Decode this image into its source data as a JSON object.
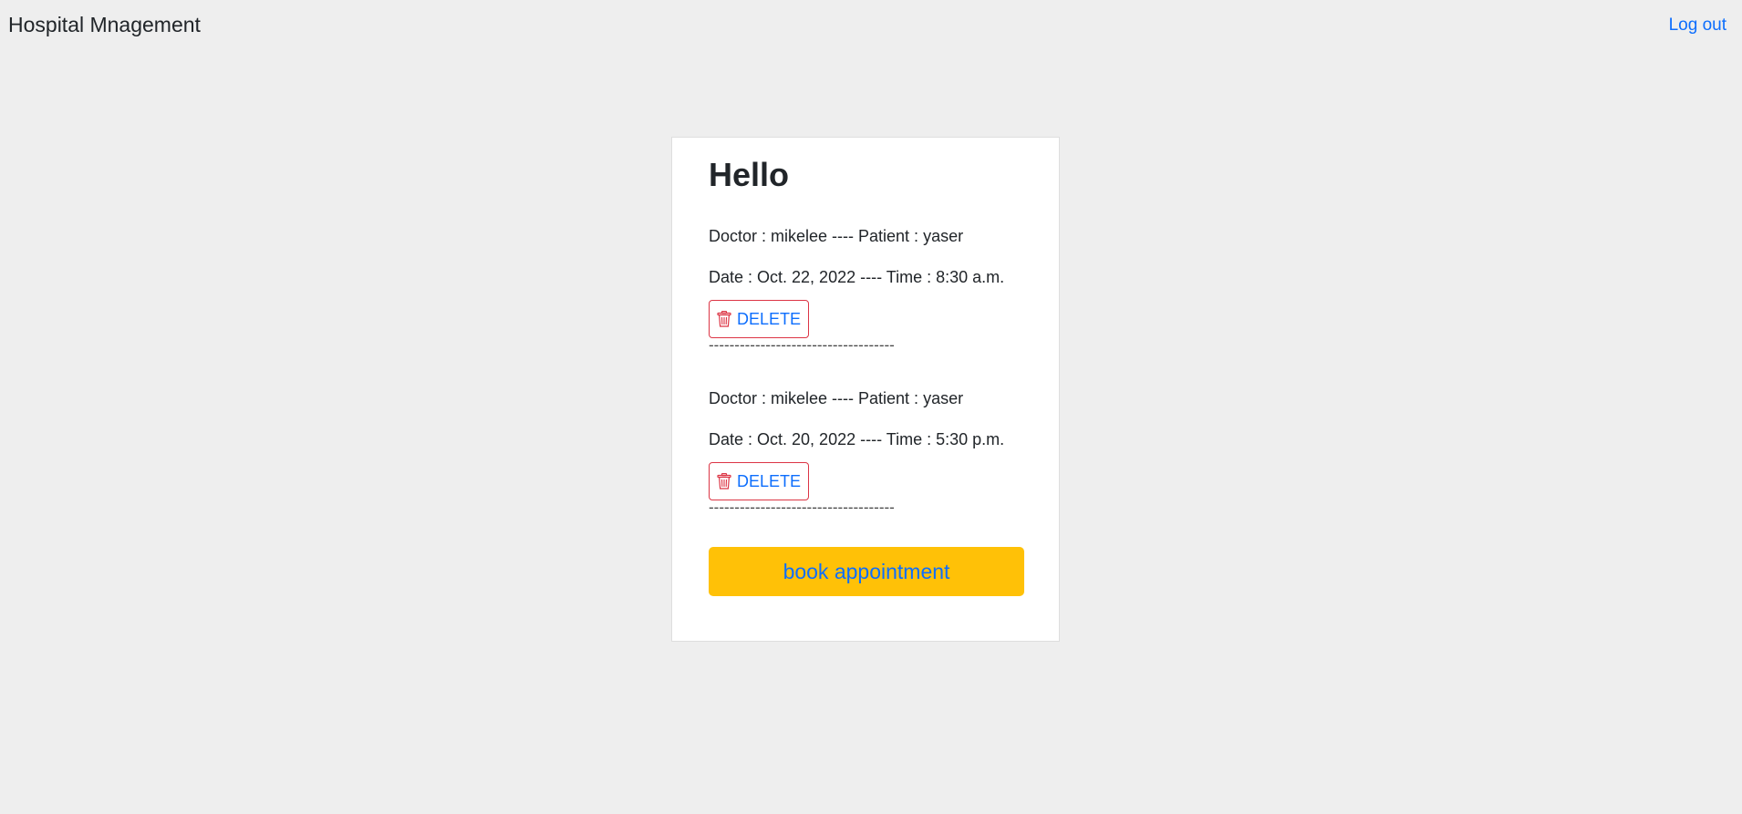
{
  "header": {
    "brand": "Hospital Mnagement",
    "logout_label": "Log out"
  },
  "main": {
    "greeting": "Hello",
    "appointments": [
      {
        "line1": "Doctor : mikelee ---- Patient : yaser",
        "line2": "Date : Oct. 22, 2022 ---- Time : 8:30 a.m.",
        "delete_label": "DELETE",
        "divider": "------------------------------------"
      },
      {
        "line1": "Doctor : mikelee ---- Patient : yaser",
        "line2": "Date : Oct. 20, 2022 ---- Time : 5:30 p.m.",
        "delete_label": "DELETE",
        "divider": "------------------------------------"
      }
    ],
    "book_label": "book appointment"
  },
  "colors": {
    "background": "#eeeeee",
    "link": "#0d6efd",
    "danger": "#dc3545",
    "warning": "#ffc107"
  },
  "icons": {
    "delete": "trash-icon"
  }
}
